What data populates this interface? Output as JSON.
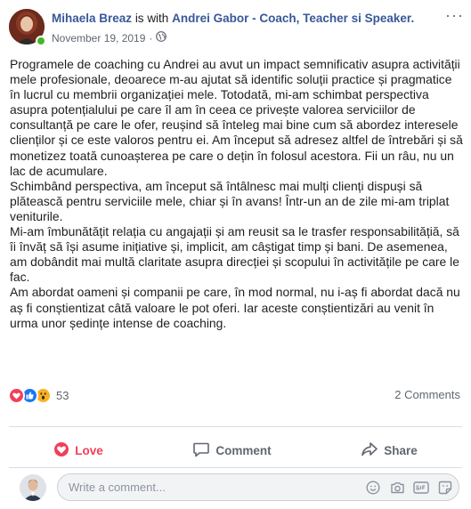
{
  "post": {
    "author": "Mihaela Breaz",
    "with_text": "is with",
    "tagged": "Andrei Gabor - Coach, Teacher si Speaker.",
    "date": "November 19, 2019",
    "separator": "·",
    "privacy_icon": "globe-icon",
    "paragraphs": [
      "Programele de coaching cu Andrei au avut un impact semnificativ asupra activității mele profesionale, deoarece m-au ajutat să identific soluții practice și pragmatice în lucrul cu membrii organizației mele. Totodată, mi-am schimbat perspectiva asupra potențialului pe care îl am în ceea ce privește valorea serviciilor de consultanță pe care le ofer, reușind să înteleg mai bine cum să abordez interesele clienților și ce este valoros pentru ei. Am început să adresez altfel de întrebări și să monetizez toată cunoașterea pe care o dețin în folosul acestora. Fii un râu, nu un lac de acumulare.",
      "Schimbând perspectiva, am început să întâlnesc mai mulți clienți dispuși să plătească pentru serviciile mele, chiar și în avans! Într-un an de zile mi-am triplat veniturile.",
      "Mi-am îmbunătățit relația cu angajații și am reusit sa le trasfer responsabilitățiă, să îi învăț să își asume inițiative și, implicit, am câștigat timp și bani. De asemenea, am dobândit mai multă claritate asupra direcției și scopului în activitățile pe care le fac.",
      "Am abordat oameni și companii pe care, în mod normal, nu i-aș fi abordat dacă nu aș fi conștientizat câtă valoare le pot oferi. Iar aceste conștientizări au venit în urma unor ședințe intense de coaching."
    ]
  },
  "reactions": {
    "count": "53",
    "types": [
      "love-icon",
      "like-icon",
      "wow-icon"
    ]
  },
  "comments_count": "2 Comments",
  "actions": {
    "love": "Love",
    "comment": "Comment",
    "share": "Share"
  },
  "comment_box": {
    "placeholder": "Write a comment..."
  },
  "colors": {
    "link": "#385898",
    "love": "#f33e58",
    "like": "#1877f2",
    "wow": "#f7b125",
    "online": "#42b72a",
    "secondary_text": "#606770"
  }
}
